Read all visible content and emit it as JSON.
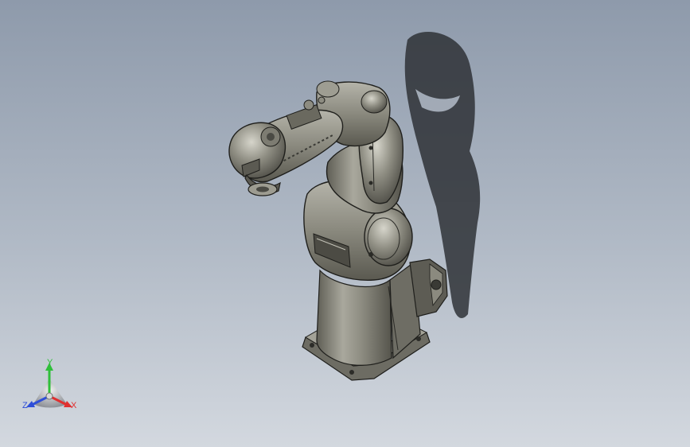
{
  "viewport": {
    "background_top": "#8e9aab",
    "background_bottom": "#d3d8df"
  },
  "model": {
    "body_color": "#8a897e",
    "shadow_color": "#2f3237",
    "outline_color": "#1f1f1c"
  },
  "triad": {
    "x": {
      "label": "X",
      "color": "#e03030"
    },
    "y": {
      "label": "Y",
      "color": "#2fbf3a"
    },
    "z": {
      "label": "Z",
      "color": "#2f4fd8"
    }
  }
}
